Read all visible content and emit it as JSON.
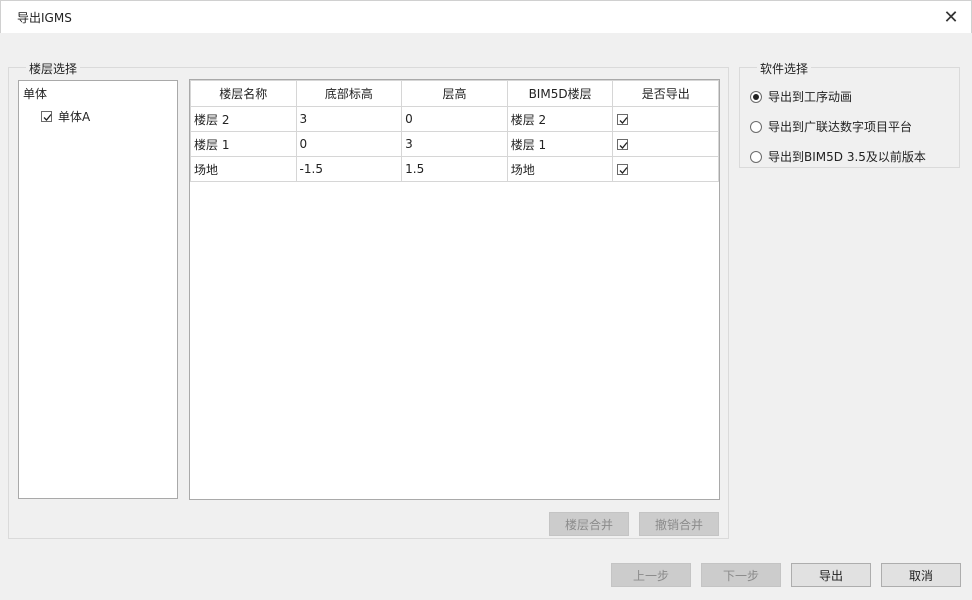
{
  "window": {
    "title": "导出IGMS",
    "close_glyph": "✕"
  },
  "floor_group": {
    "title": "楼层选择"
  },
  "tree": {
    "root_label": "单体",
    "nodes": [
      {
        "label": "单体A",
        "checked": true
      }
    ]
  },
  "table": {
    "headers": [
      "楼层名称",
      "底部标高",
      "层高",
      "BIM5D楼层",
      "是否导出"
    ],
    "rows": [
      {
        "name": "楼层 2",
        "bottom": "3",
        "height": "0",
        "bim": "楼层 2",
        "export": true
      },
      {
        "name": "楼层 1",
        "bottom": "0",
        "height": "3",
        "bim": "楼层 1",
        "export": true
      },
      {
        "name": "场地",
        "bottom": "-1.5",
        "height": "1.5",
        "bim": "场地",
        "export": true
      }
    ]
  },
  "merge_buttons": {
    "merge": "楼层合并",
    "unmerge": "撤销合并"
  },
  "software_group": {
    "title": "软件选择",
    "options": [
      {
        "label": "导出到工序动画",
        "selected": true
      },
      {
        "label": "导出到广联达数字项目平台",
        "selected": false
      },
      {
        "label": "导出到BIM5D 3.5及以前版本",
        "selected": false
      }
    ]
  },
  "footer": {
    "prev": "上一步",
    "next": "下一步",
    "export": "导出",
    "cancel": "取消"
  }
}
